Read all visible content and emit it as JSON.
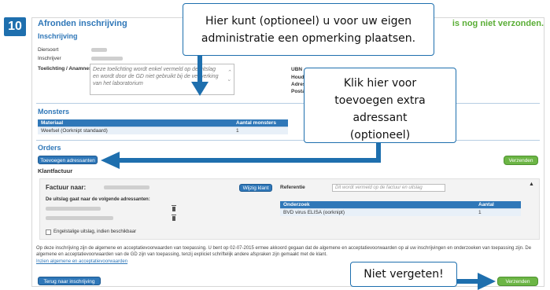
{
  "step_number": "10",
  "panel": {
    "title": "Afronden inschrijving",
    "status": "is nog niet verzonden."
  },
  "inschrijving": {
    "heading": "Inschrijving",
    "labels": {
      "diersoort": "Diersoort",
      "inschrijver": "Inschrijver",
      "toelichting": "Toelichting / Anamnese"
    },
    "toelichting_placeholder": "Deze toelichting wordt enkel vermeld op de uitslag en wordt door de GD niet gebruikt bij de verwerking van het laboratorium",
    "right_labels": [
      "UBN",
      "Houd",
      "Adres",
      "Posta"
    ]
  },
  "monsters": {
    "heading": "Monsters",
    "columns": [
      "Materiaal",
      "Aantal monsters"
    ],
    "rows": [
      [
        "Weefsel (Oorknipt standaard)",
        "1"
      ]
    ]
  },
  "orders": {
    "heading": "Orders",
    "add_addressee_button": "Toevoegen adressanten",
    "verzenden_top": "Verzenden",
    "klantfactuur_heading": "Klantfactuur"
  },
  "factuur": {
    "label": "Factuur naar:",
    "wijzig_button": "Wijzig klant",
    "referentie_label": "Referentie",
    "referentie_placeholder": "Dit wordt vermeld op de factuur en uitslag",
    "uitslag_label": "De uitslag gaat naar de volgende adressanten:",
    "checkbox_label": "Engelstalige uitslag, indien beschikbaar",
    "onderzoek_columns": [
      "Onderzoek",
      "Aantal"
    ],
    "onderzoek_rows": [
      [
        "BVD virus ELISA (oorknipt)",
        "1"
      ]
    ]
  },
  "terms_text": "Op deze inschrijving zijn de algemene en acceptatievoorwaarden van toepassing. U bent op 02-07-2015 ermee akkoord gegaan dat de algemene en acceptatievoorwaarden op al uw inschrijvingen en onderzoeken van toepassing zijn. De algemene en acceptatievoorwaarden van de GD zijn van toepassing, tenzij expliciet schriftelijk andere afspraken zijn gemaakt met de klant.",
  "terms_link": "Inzien algemene en acceptatievoorwaarden",
  "footer": {
    "back_button": "Terug naar inschrijving",
    "verzenden_bottom": "Verzenden"
  },
  "callouts": {
    "opmerking": "Hier kunt (optioneel) u voor uw eigen administratie een opmerking plaatsen.",
    "adressant": "Klik hier voor toevoegen extra adressant (optioneel)",
    "vergeten": "Niet vergeten!"
  },
  "colors": {
    "accent_blue": "#2f77b8",
    "callout_border": "#1e6fae",
    "send_green": "#6cb545",
    "status_green": "#5aae36"
  }
}
